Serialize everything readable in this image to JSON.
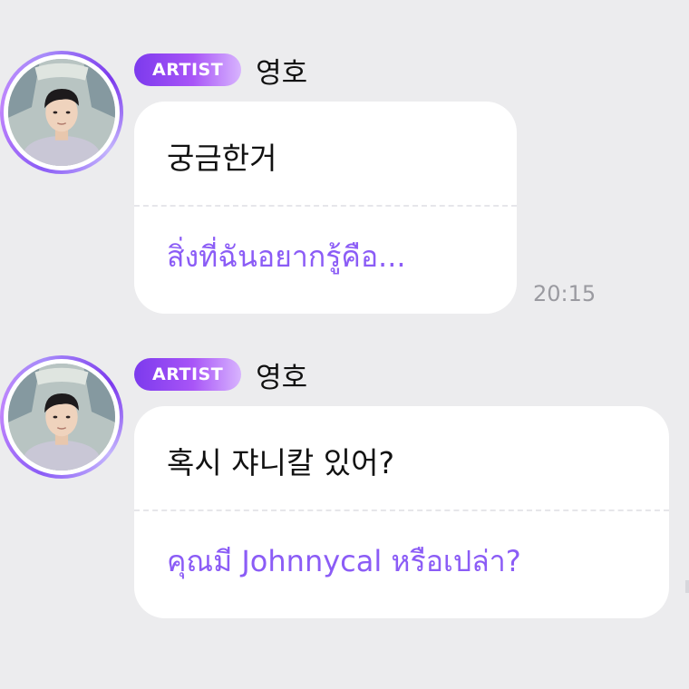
{
  "messages": [
    {
      "badge": "ARTIST",
      "sender": "영호",
      "original_text": "궁금한거",
      "translated_text": "สิ่งที่ฉันอยากรู้คือ...",
      "time": "20:15"
    },
    {
      "badge": "ARTIST",
      "sender": "영호",
      "original_text": "혹시 쟈니칼 있어?",
      "translated_text": "คุณมี Johnnycal หรือเปล่า?",
      "time": ""
    }
  ],
  "colors": {
    "background": "#ececee",
    "bubble": "#ffffff",
    "translation_text": "#8b5cf6",
    "badge_start": "#7c3aed",
    "badge_end": "#d8b4fe",
    "timestamp": "#9a9aa0"
  },
  "icons": {
    "avatar": "artist-profile-photo"
  }
}
